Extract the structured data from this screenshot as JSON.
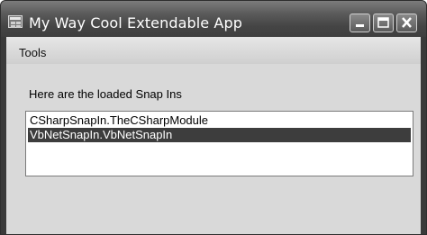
{
  "window": {
    "title": "My Way Cool Extendable App"
  },
  "menubar": {
    "items": [
      {
        "label": "Tools"
      }
    ]
  },
  "main": {
    "prompt": "Here are the loaded Snap Ins",
    "snapins": [
      {
        "label": "CSharpSnapIn.TheCSharpModule",
        "selected": false
      },
      {
        "label": "VbNetSnapIn.VbNetSnapIn",
        "selected": true
      }
    ]
  },
  "icons": {
    "app": "application-icon",
    "minimize": "minimize-icon",
    "maximize": "maximize-icon",
    "close": "close-icon"
  },
  "colors": {
    "selection": "#3d3d3d",
    "client_background": "#d9d9d9"
  }
}
